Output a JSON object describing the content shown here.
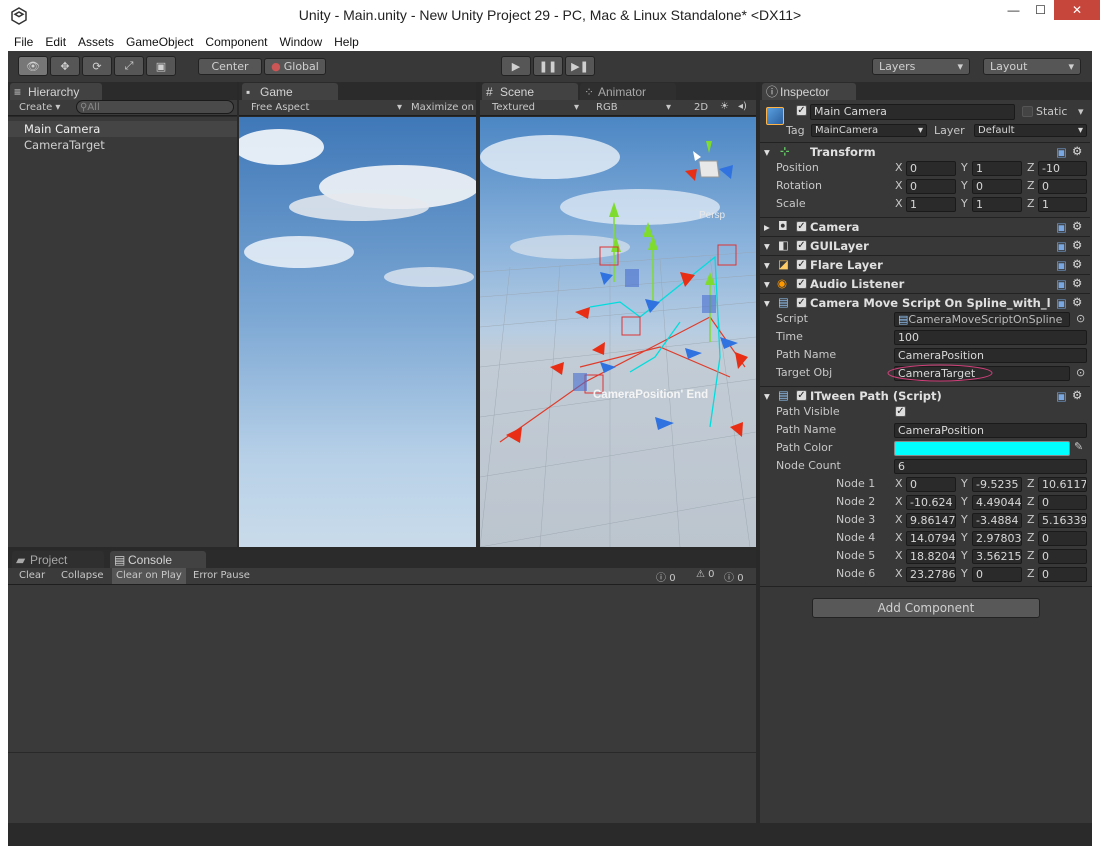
{
  "window": {
    "title": "Unity - Main.unity - New Unity Project 29 - PC, Mac & Linux Standalone* <DX11>",
    "minimize": "—",
    "maximize": "☐",
    "close": "✕"
  },
  "menu": [
    "File",
    "Edit",
    "Assets",
    "GameObject",
    "Component",
    "Window",
    "Help"
  ],
  "toolbar": {
    "center": "Center",
    "global": "Global",
    "layers": "Layers",
    "layout": "Layout"
  },
  "hierarchy": {
    "tab": "Hierarchy",
    "create": "Create",
    "search_placeholder": "All",
    "items": [
      "Main Camera",
      "CameraTarget"
    ]
  },
  "game": {
    "tab": "Game",
    "aspect": "Free Aspect",
    "maximize": "Maximize on"
  },
  "scene": {
    "tab": "Scene",
    "animator": "Animator",
    "shading": "Textured",
    "channels": "RGB",
    "mode2d": "2D",
    "persp": "Persp",
    "label": "CameraPosition' End"
  },
  "bottom": {
    "project_tab": "Project",
    "console_tab": "Console",
    "clear": "Clear",
    "collapse": "Collapse",
    "clear_on_play": "Clear on Play",
    "error_pause": "Error Pause",
    "count_log": "0",
    "count_warn": "0",
    "count_err": "0"
  },
  "inspector": {
    "tab": "Inspector",
    "object_name": "Main Camera",
    "static": "Static",
    "tag_label": "Tag",
    "tag": "MainCamera",
    "layer_label": "Layer",
    "layer": "Default",
    "transform": {
      "title": "Transform",
      "rows": [
        {
          "label": "Position",
          "x": "0",
          "y": "1",
          "z": "-10"
        },
        {
          "label": "Rotation",
          "x": "0",
          "y": "0",
          "z": "0"
        },
        {
          "label": "Scale",
          "x": "1",
          "y": "1",
          "z": "1"
        }
      ]
    },
    "components": [
      "Camera",
      "GUILayer",
      "Flare Layer",
      "Audio Listener"
    ],
    "script": {
      "title": "Camera Move Script On Spline_with_l",
      "script_label": "Script",
      "script_value": "CameraMoveScriptOnSpline",
      "time_label": "Time",
      "time_value": "100",
      "path_label": "Path Name",
      "path_value": "CameraPosition",
      "target_label": "Target Obj",
      "target_value": "CameraTarget"
    },
    "itween": {
      "title": "ITween Path (Script)",
      "visible_label": "Path Visible",
      "path_label": "Path Name",
      "path_value": "CameraPosition",
      "color_label": "Path Color",
      "color": "#00ffff",
      "count_label": "Node Count",
      "count_value": "6",
      "nodes": [
        {
          "label": "Node 1",
          "x": "0",
          "y": "-9.5235",
          "z": "10.6117"
        },
        {
          "label": "Node 2",
          "x": "-10.624",
          "y": "4.49044",
          "z": "0"
        },
        {
          "label": "Node 3",
          "x": "9.86147",
          "y": "-3.4884",
          "z": "5.16339"
        },
        {
          "label": "Node 4",
          "x": "14.0794",
          "y": "2.97803",
          "z": "0"
        },
        {
          "label": "Node 5",
          "x": "18.8204",
          "y": "3.56215",
          "z": "0"
        },
        {
          "label": "Node 6",
          "x": "23.2786",
          "y": "0",
          "z": "0"
        }
      ]
    },
    "add_component": "Add Component"
  },
  "axes": {
    "x": "X",
    "y": "Y",
    "z": "Z"
  }
}
